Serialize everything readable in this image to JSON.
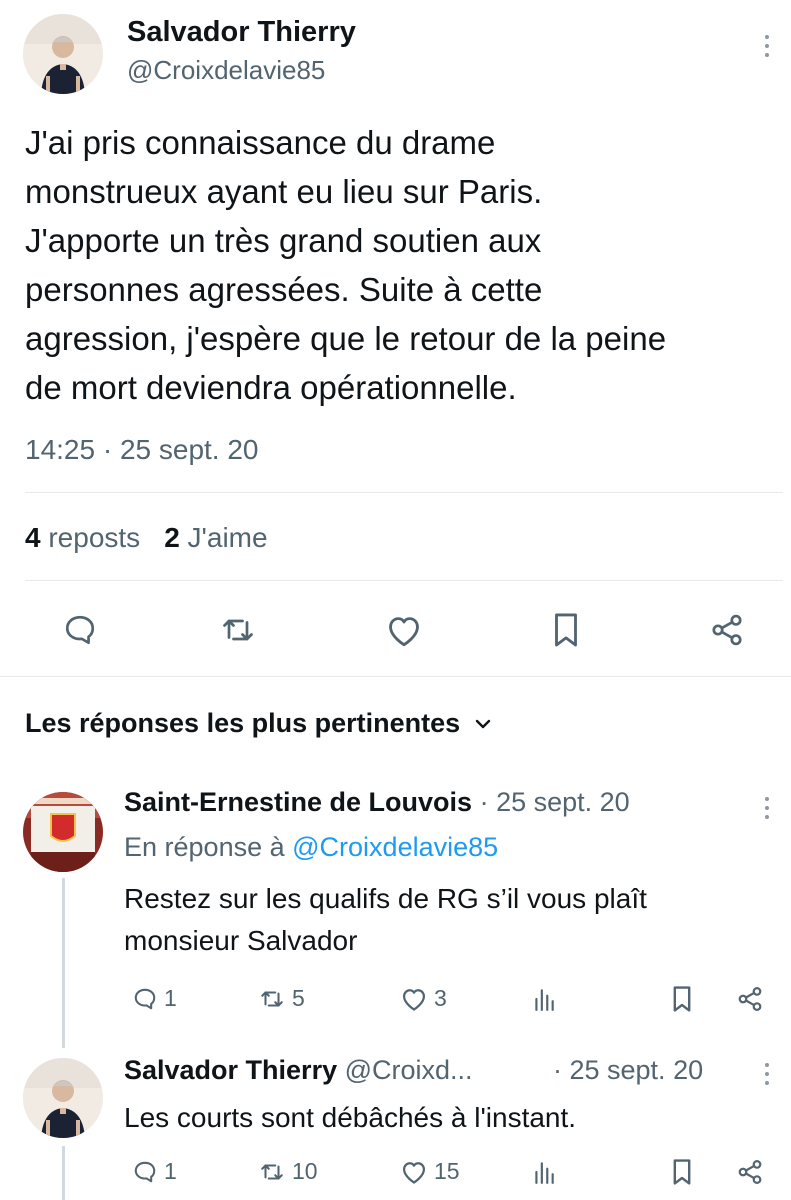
{
  "tweet": {
    "author_name": "Salvador Thierry",
    "author_handle": "@Croixdelavie85",
    "text": "J'ai pris connaissance du drame monstrueux ayant eu lieu sur Paris. J'apporte un très grand soutien aux personnes agressées. Suite à cette agression, j'espère que le retour de la peine de mort deviendra opérationnelle.",
    "text_lines": [
      "J'ai pris connaissance du drame",
      "monstrueux ayant eu lieu sur Paris.",
      "J'apporte un très grand soutien aux",
      "personnes agressées. Suite à cette",
      "agression, j'espère que le retour de la peine",
      "de mort deviendra opérationnelle."
    ],
    "timestamp": "14:25 · 25 sept. 20",
    "reposts_count": "4",
    "reposts_label": "reposts",
    "likes_count": "2",
    "likes_label": "J'aime"
  },
  "replies_header": {
    "label": "Les réponses les plus pertinentes"
  },
  "replies": [
    {
      "author_name": "Saint-Ernestine de Louvois",
      "date": "· 25 sept. 20",
      "reply_prefix": "En réponse à",
      "reply_to": "@Croixdelavie85",
      "text_lines": [
        "Restez sur les qualifs de RG s’il vous plaît",
        "monsieur Salvador"
      ],
      "replies": "1",
      "reposts": "5",
      "likes": "3"
    },
    {
      "author_name": "Salvador Thierry",
      "author_handle": "@Croixd...",
      "date": "· 25 sept. 20",
      "text_lines": [
        "Les courts sont débâchés à l'instant."
      ],
      "replies": "1",
      "reposts": "10",
      "likes": "15"
    }
  ],
  "icons": {
    "reply": "speech-bubble-icon",
    "repost": "repost-arrows-icon",
    "like": "heart-icon",
    "bookmark": "bookmark-icon",
    "share": "share-nodes-icon",
    "views": "bar-chart-icon",
    "more": "vertical-ellipsis-icon",
    "expand": "chevron-down-icon"
  },
  "colors": {
    "text": "#0f1419",
    "muted": "#536471",
    "link": "#1d9bf0",
    "divider": "#e7e9ea"
  }
}
